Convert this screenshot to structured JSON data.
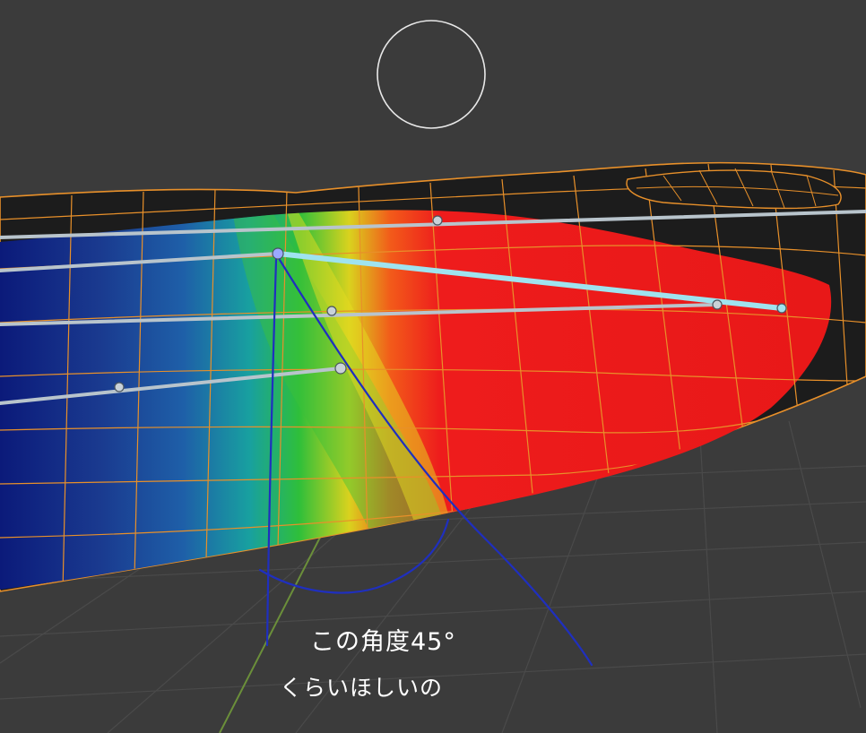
{
  "viewport": {
    "background_color": "#3b3b3b",
    "grid_color": "#4a4a4a",
    "axis_color": "#6b8f3a"
  },
  "mesh": {
    "wire_color": "#e8902a",
    "shell_color": "#1c1c1c",
    "weight_map_colors": [
      "#0b1a7a",
      "#1e5fa8",
      "#18a0a0",
      "#2fbf3a",
      "#d9d21e",
      "#f25a1a",
      "#ee1c1c"
    ]
  },
  "bones": {
    "color": "#b8c4cc",
    "selected_color": "#9fe3ef"
  },
  "brush_cursor": {
    "color": "#e8e8e8"
  },
  "annotation": {
    "ink_color": "#1f2fbf",
    "text_color": "#ffffff",
    "line1": "この角度45°",
    "line2": "くらいほしいの"
  }
}
